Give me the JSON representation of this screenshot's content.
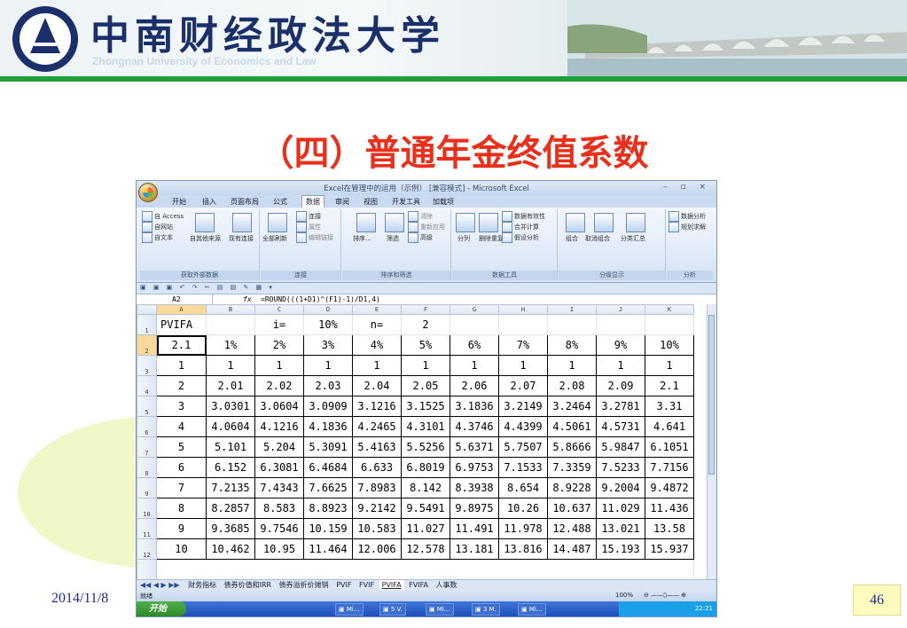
{
  "slide": {
    "university_cn": "中南财经政法大学",
    "university_en": "Zhongnan University of Economics and Law",
    "title": "（四）普通年金终值系数",
    "date": "2014/11/8",
    "page_number": "46"
  },
  "excel": {
    "window_title": "Excel在管理中的运用（示例） [兼容模式] - Microsoft Excel",
    "window_controls": "– ▫ ×",
    "tabs": [
      "开始",
      "插入",
      "页面布局",
      "公式",
      "数据",
      "审阅",
      "视图",
      "开发工具",
      "加载项"
    ],
    "active_tab": "数据",
    "ribbon": {
      "groups": [
        {
          "name": "获取外部数据",
          "items": [
            "自 Access",
            "自网站",
            "自文本",
            "自其他来源",
            "现有连接"
          ]
        },
        {
          "name": "连接",
          "items": [
            "全部刷新",
            "连接",
            "属性",
            "编辑链接"
          ]
        },
        {
          "name": "排序和筛选",
          "items": [
            "排序...",
            "筛选",
            "清除",
            "重新应用",
            "高级"
          ]
        },
        {
          "name": "数据工具",
          "items": [
            "分列",
            "删除重复项",
            "数据有效性",
            "合并计算",
            "假设分析"
          ]
        },
        {
          "name": "分级显示",
          "items": [
            "组合",
            "取消组合",
            "分类汇总"
          ]
        },
        {
          "name": "分析",
          "items": [
            "数据分析",
            "规划求解"
          ]
        }
      ]
    },
    "name_box": "A2",
    "formula": "=ROUND(((1+D1)^(F1)-1)/D1,4)",
    "column_headers": [
      "A",
      "B",
      "C",
      "D",
      "E",
      "F",
      "G",
      "H",
      "I",
      "J",
      "K"
    ],
    "row1": [
      "PVIFA",
      "",
      "i=",
      "10%",
      "n=",
      "2",
      "",
      "",
      "",
      "",
      ""
    ],
    "rows": [
      {
        "n": "2",
        "cells": [
          "2.1",
          "1%",
          "2%",
          "3%",
          "4%",
          "5%",
          "6%",
          "7%",
          "8%",
          "9%",
          "10%"
        ]
      },
      {
        "n": "3",
        "cells": [
          "1",
          "1",
          "1",
          "1",
          "1",
          "1",
          "1",
          "1",
          "1",
          "1",
          "1"
        ]
      },
      {
        "n": "4",
        "cells": [
          "2",
          "2.01",
          "2.02",
          "2.03",
          "2.04",
          "2.05",
          "2.06",
          "2.07",
          "2.08",
          "2.09",
          "2.1"
        ]
      },
      {
        "n": "5",
        "cells": [
          "3",
          "3.0301",
          "3.0604",
          "3.0909",
          "3.1216",
          "3.1525",
          "3.1836",
          "3.2149",
          "3.2464",
          "3.2781",
          "3.31"
        ]
      },
      {
        "n": "6",
        "cells": [
          "4",
          "4.0604",
          "4.1216",
          "4.1836",
          "4.2465",
          "4.3101",
          "4.3746",
          "4.4399",
          "4.5061",
          "4.5731",
          "4.641"
        ]
      },
      {
        "n": "7",
        "cells": [
          "5",
          "5.101",
          "5.204",
          "5.3091",
          "5.4163",
          "5.5256",
          "5.6371",
          "5.7507",
          "5.8666",
          "5.9847",
          "6.1051"
        ]
      },
      {
        "n": "8",
        "cells": [
          "6",
          "6.152",
          "6.3081",
          "6.4684",
          "6.633",
          "6.8019",
          "6.9753",
          "7.1533",
          "7.3359",
          "7.5233",
          "7.7156"
        ]
      },
      {
        "n": "9",
        "cells": [
          "7",
          "7.2135",
          "7.4343",
          "7.6625",
          "7.8983",
          "8.142",
          "8.3938",
          "8.654",
          "8.9228",
          "9.2004",
          "9.4872"
        ]
      },
      {
        "n": "10",
        "cells": [
          "8",
          "8.2857",
          "8.583",
          "8.8923",
          "9.2142",
          "9.5491",
          "9.8975",
          "10.26",
          "10.637",
          "11.029",
          "11.436"
        ]
      },
      {
        "n": "11",
        "cells": [
          "9",
          "9.3685",
          "9.7546",
          "10.159",
          "10.583",
          "11.027",
          "11.491",
          "11.978",
          "12.488",
          "13.021",
          "13.58"
        ]
      },
      {
        "n": "12",
        "cells": [
          "10",
          "10.462",
          "10.95",
          "11.464",
          "12.006",
          "12.578",
          "13.181",
          "13.816",
          "14.487",
          "15.193",
          "15.937"
        ]
      }
    ],
    "sheet_tabs": [
      "财务指标",
      "债券价值和IRR",
      "债券溢折价摊销",
      "PVIF",
      "FVIF",
      "PVIFA",
      "FVIFA",
      "人事数"
    ],
    "active_sheet": "PVIFA",
    "status": "就绪",
    "zoom": "100%",
    "taskbar": {
      "start": "开始",
      "clock": "22:21"
    }
  },
  "colors": {
    "title_red": "#e8301c",
    "brand_blue": "#1b2f6b",
    "banner_green": "#20a03a"
  }
}
